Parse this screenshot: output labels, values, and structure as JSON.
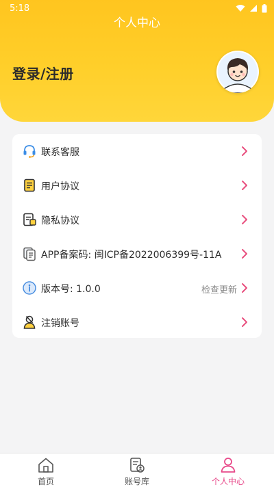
{
  "status_bar": {
    "time": "5:18"
  },
  "header": {
    "title": "个人中心",
    "login_label": "登录/注册"
  },
  "menu": [
    {
      "label": "联系客服",
      "icon": "headset-icon"
    },
    {
      "label": "用户协议",
      "icon": "document-icon"
    },
    {
      "label": "隐私协议",
      "icon": "privacy-document-icon"
    },
    {
      "label": "APP备案码: 闽ICP备2022006399号-11A",
      "icon": "copy-document-icon"
    },
    {
      "label": "版本号: 1.0.0",
      "right_text": "检查更新",
      "icon": "info-icon"
    },
    {
      "label": "注销账号",
      "icon": "user-cancel-icon"
    }
  ],
  "tabbar": [
    {
      "label": "首页",
      "icon": "home-icon",
      "active": false
    },
    {
      "label": "账号库",
      "icon": "account-library-icon",
      "active": false
    },
    {
      "label": "个人中心",
      "icon": "person-icon",
      "active": true
    }
  ],
  "colors": {
    "header": "#ffc51f",
    "accent": "#e84a8a",
    "background": "#f4f4f5"
  }
}
